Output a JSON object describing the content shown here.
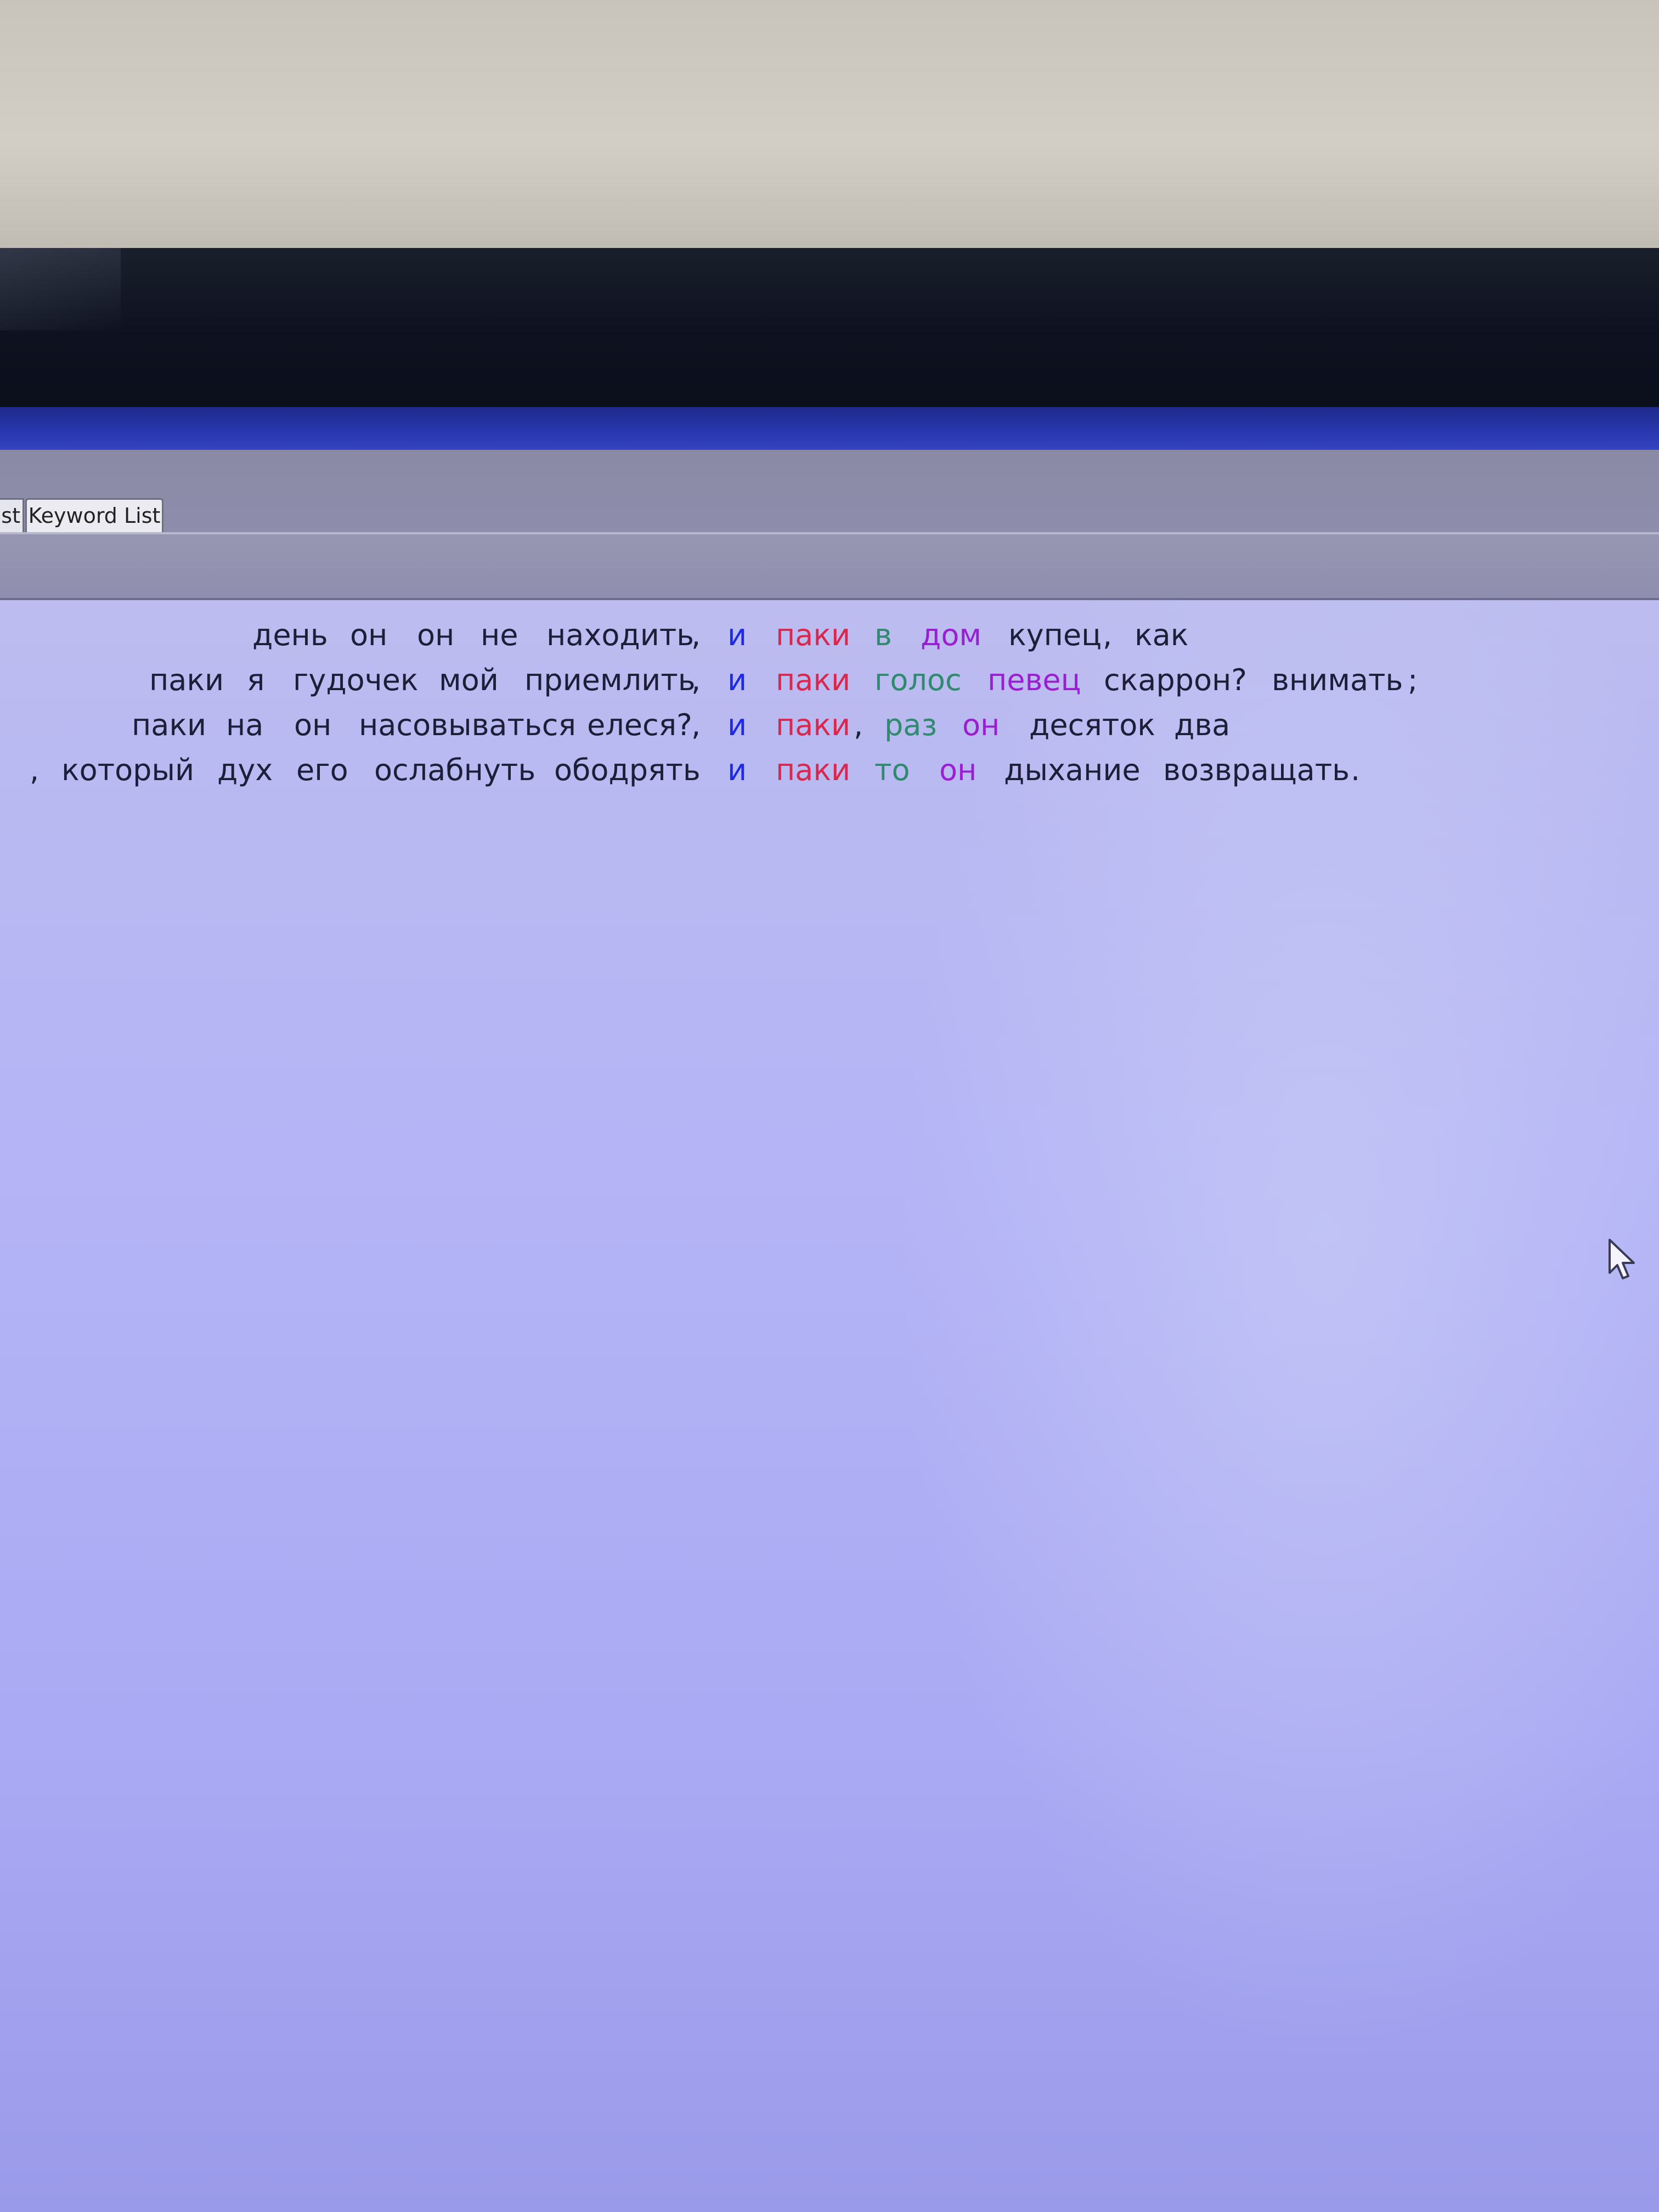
{
  "tabs": {
    "partial_label": "st",
    "keyword_label": "Keyword List"
  },
  "colors": {
    "context": "#1d1f38",
    "search_term": "#1e2ae6",
    "collocate_1": "#d8284e",
    "collocate_2": "#2f8a6e",
    "collocate_3": "#9a1fd2",
    "background": "#b4b4f6"
  },
  "kwic": [
    {
      "left": [
        "день",
        "он",
        "он",
        "не",
        "находить",
        ","
      ],
      "hit": "и",
      "right": [
        {
          "text": "паки",
          "style": "c-red"
        },
        {
          "text": "в",
          "style": "c-green"
        },
        {
          "text": "дом",
          "style": "c-purple"
        },
        {
          "text": "купец",
          "style": "ctx"
        },
        {
          "text": ",",
          "style": "ctx"
        },
        {
          "text": "как",
          "style": "ctx"
        }
      ]
    },
    {
      "left": [
        "паки",
        "я",
        "гудочек",
        "мой",
        "приемлить",
        ","
      ],
      "hit": "и",
      "right": [
        {
          "text": "паки",
          "style": "c-red"
        },
        {
          "text": "голос",
          "style": "c-green"
        },
        {
          "text": "певец",
          "style": "c-purple"
        },
        {
          "text": "скаррон?",
          "style": "ctx"
        },
        {
          "text": "внимать",
          "style": "ctx"
        },
        {
          "text": ";",
          "style": "ctx"
        }
      ]
    },
    {
      "left": [
        "паки",
        "на",
        "он",
        "насовываться",
        "елеся?",
        ","
      ],
      "hit": "и",
      "right": [
        {
          "text": "паки",
          "style": "c-red"
        },
        {
          "text": ",",
          "style": "ctx"
        },
        {
          "text": "раз",
          "style": "c-green"
        },
        {
          "text": "он",
          "style": "c-purple"
        },
        {
          "text": "десяток",
          "style": "ctx"
        },
        {
          "text": "два",
          "style": "ctx"
        }
      ]
    },
    {
      "left": [
        ",",
        "который",
        "дух",
        "его",
        "ослабнуть",
        "ободрять"
      ],
      "hit": "и",
      "right": [
        {
          "text": "паки",
          "style": "c-red"
        },
        {
          "text": "то",
          "style": "c-green"
        },
        {
          "text": "он",
          "style": "c-purple"
        },
        {
          "text": "дыхание",
          "style": "ctx"
        },
        {
          "text": "возвращать",
          "style": "ctx"
        },
        {
          "text": ".",
          "style": "ctx"
        }
      ]
    }
  ]
}
